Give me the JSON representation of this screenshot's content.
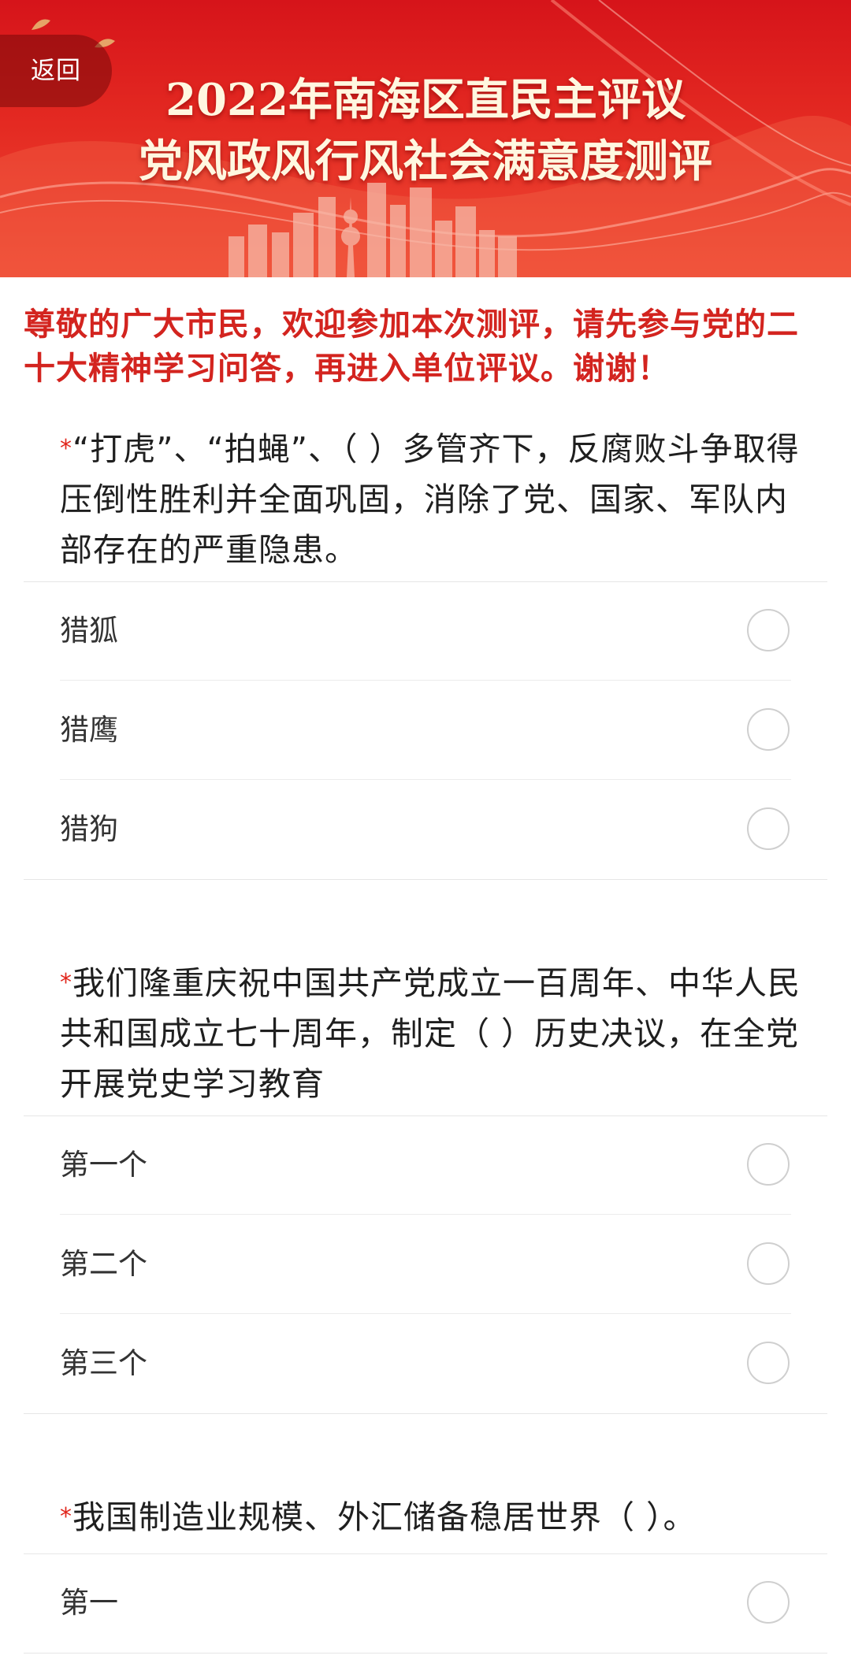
{
  "header": {
    "back_label": "返回",
    "title_line1": "2022年南海区直民主评议",
    "title_line2": "党风政风行风社会满意度测评",
    "colors": {
      "banner": "#d6141a",
      "title_text": "#fff7e0"
    }
  },
  "notice": "尊敬的广大市民，欢迎参加本次测评，请先参与党的二十大精神学习问答，再进入单位评议。谢谢！",
  "questions": [
    {
      "required_mark": "*",
      "text": "“打虎”、“拍蝇”、（ ）多管齐下，反腐败斗争取得压倒性胜利并全面巩固，消除了党、国家、军队内部存在的严重隐患。",
      "options": [
        "猎狐",
        "猎鹰",
        "猎狗"
      ]
    },
    {
      "required_mark": "*",
      "text": "我们隆重庆祝中国共产党成立一百周年、中华人民共和国成立七十周年，制定（ ）历史决议，在全党开展党史学习教育",
      "options": [
        "第一个",
        "第二个",
        "第三个"
      ]
    },
    {
      "required_mark": "*",
      "text": "我国制造业规模、外汇储备稳居世界（ ）。",
      "options": [
        "第一"
      ]
    }
  ],
  "colors": {
    "accent_red": "#d3241f",
    "required_star": "#e1251b"
  }
}
